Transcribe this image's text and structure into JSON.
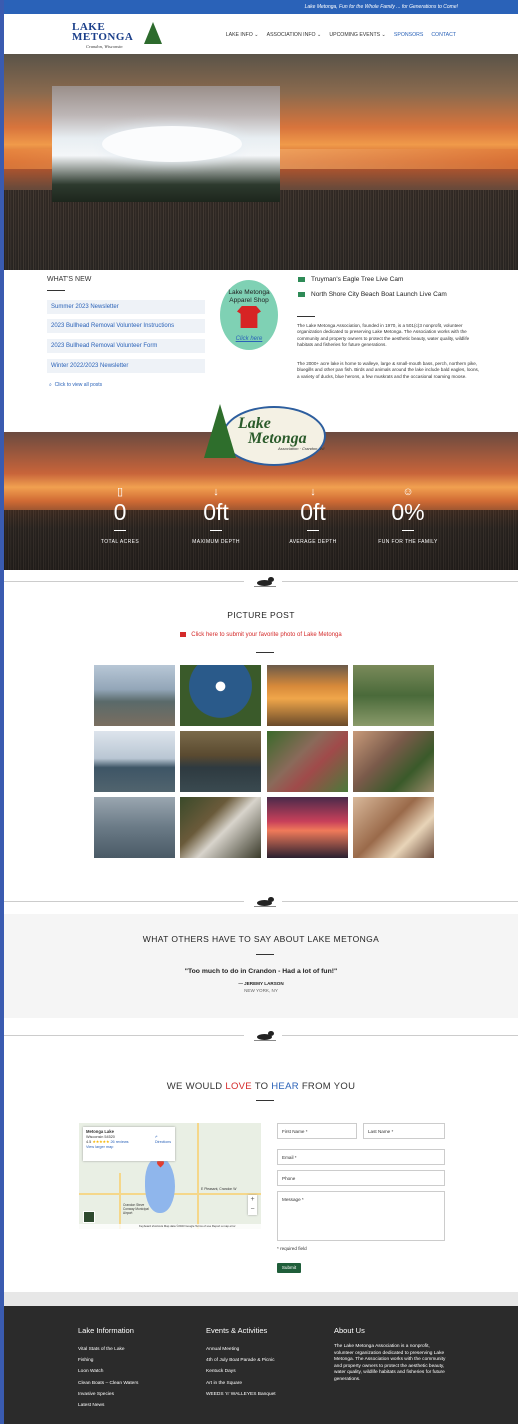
{
  "topbar": {
    "tagline": "Lake Metonga, Fun for the Whole Family ... for Generations to Come!"
  },
  "logo": {
    "line1": "LAKE",
    "line2": "METONGA",
    "line3": "Crandon, Wisconsin"
  },
  "nav": {
    "items": [
      {
        "label": "LAKE INFO",
        "dropdown": true
      },
      {
        "label": "ASSOCIATION INFO",
        "dropdown": true
      },
      {
        "label": "UPCOMING EVENTS",
        "dropdown": true
      },
      {
        "label": "SPONSORS",
        "dropdown": false
      },
      {
        "label": "CONTACT",
        "dropdown": false
      }
    ],
    "chevron": "⌄"
  },
  "whats_new": {
    "title": "WHAT'S NEW",
    "items": [
      "Summer 2023 Newsletter",
      "2023 Bullhead Removal Volunteer Instructions",
      "2023 Bullhead Removal Volunteer Form",
      "Winter 2022/2023 Newsletter"
    ],
    "view_all": "Click to view all posts"
  },
  "apparel": {
    "title_line1": "Lake Metonga",
    "title_line2": "Apparel Shop",
    "cta": "Click here"
  },
  "cams": [
    "Truyman's Eagle Tree Live Cam",
    "North Shore City Beach Boat Launch Live Cam"
  ],
  "about": {
    "p1": "The Lake Metonga Association, founded in 1970, is a 501(c)3 nonprofit, volunteer organization dedicated to preserving Lake Metonga. The Association works with the community and property owners to protect the aesthetic beauty, water quality, wildlife habitats and fisheries for future generations.",
    "p2": "The 2000+ acre lake is home to walleye, large & small-mouth bass, perch, northern pike, bluegills and other pan fish. Birds and animals around the lake include bald eagles, loons, a variety of ducks, blue herons, a few muskrats and the occasional roaming moose."
  },
  "badge": {
    "name_line1": "Lake",
    "name_line2": "Metonga",
    "sub": "Association · Crandon, WI"
  },
  "stats": [
    {
      "icon": "map-icon",
      "glyph": "▯",
      "value": "0",
      "label": "TOTAL ACRES"
    },
    {
      "icon": "arrow-down-icon",
      "glyph": "↓",
      "value": "0ft",
      "label": "MAXIMUM DEPTH"
    },
    {
      "icon": "arrow-down-icon",
      "glyph": "↓",
      "value": "0ft",
      "label": "AVERAGE DEPTH"
    },
    {
      "icon": "smile-icon",
      "glyph": "☺",
      "value": "0%",
      "label": "FUN FOR THE FAMILY"
    }
  ],
  "picture_post": {
    "title": "PICTURE POST",
    "link": "Click here to submit your favorite photo of Lake Metonga"
  },
  "testimonial": {
    "title": "WHAT OTHERS HAVE TO SAY ABOUT LAKE METONGA",
    "quote": "\"Too much to do in Crandon - Had a lot of fun!\"",
    "author": "— JEREMY LARSON",
    "location": "NEW YORK, NY"
  },
  "contact": {
    "title_a": "WE WOULD ",
    "title_love": "LOVE",
    "title_b": " TO ",
    "title_hear": "HEAR",
    "title_c": " FROM YOU",
    "first_name": "First Name *",
    "last_name": "Last Name *",
    "email": "Email *",
    "phone": "Phone",
    "message": "Message *",
    "required_note": "* required field",
    "submit": "Submit"
  },
  "map": {
    "place": "Metonga Lake",
    "region": "Wisconsin 54520",
    "rating": "4.5",
    "stars": "★★★★★",
    "reviews": "26 reviews",
    "directions": "Directions",
    "larger": "View larger map",
    "road_label": "E Pleasant, Crandon W",
    "airport": "Crandon Steve Conway Municipal Airport",
    "footer": "Keyboard shortcuts   Map data ©2023 Google   Terms of use   Report a map error"
  },
  "footer": {
    "lake_info": {
      "title": "Lake Information",
      "items": [
        "Vital Stats of the Lake",
        "Fishing",
        "Loon Watch",
        "Clean Boats – Clean Waters",
        "Invasive Species",
        "Latest News"
      ]
    },
    "events": {
      "title": "Events & Activities",
      "items": [
        "Annual Meeting",
        "4th of July Boat Parade & Picnic",
        "Kentuck Days",
        "Art in the Square",
        "WEEDS 'n' WALLEYES Banquet"
      ]
    },
    "about": {
      "title": "About Us",
      "text": "The Lake Metonga Association is a nonprofit, volunteer organization dedicated to preserving Lake Metonga. The Association works with the community and property owners to protect the aesthetic beauty, water quality, wildlife habitats and fisheries for future generations."
    }
  },
  "colors": {
    "brand_blue": "#2a62b8",
    "accent_red": "#d42a2a",
    "footer_bg": "#2b2b2b",
    "submit_green": "#1f5e3a"
  }
}
